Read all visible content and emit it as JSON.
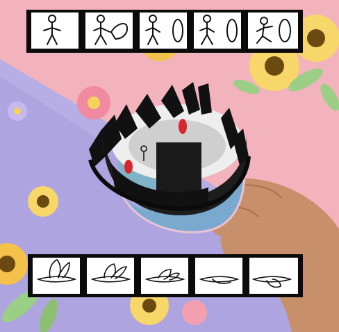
{
  "image": {
    "description_colors": {
      "pink_bg": "#f2b3bd",
      "purple_bg": "#b7aee6",
      "film_black": "#0b0b0b",
      "zoetrope_black": "#141414",
      "flower_yellow": "#f7d66a",
      "flower_center": "#6b4a12",
      "leaf_green": "#9ccf86"
    },
    "top_strip": {
      "frames": [
        {
          "label": "",
          "icon": "stick-figure-icon"
        },
        {
          "label": "",
          "icon": "stick-figure-throw-icon"
        },
        {
          "label": "",
          "icon": "stick-figure-ring-icon"
        },
        {
          "label": "",
          "icon": "stick-figure-ring-icon"
        },
        {
          "label": "",
          "icon": "stick-figure-jump-icon"
        }
      ]
    },
    "bottom_strip": {
      "frames": [
        {
          "label": "",
          "icon": "bird-wings-up-icon"
        },
        {
          "label": "",
          "icon": "bird-wings-mid-icon"
        },
        {
          "label": "",
          "icon": "bird-wings-mid-icon"
        },
        {
          "label": "",
          "icon": "bird-wings-down-icon"
        },
        {
          "label": "",
          "icon": "bird-wings-down-icon"
        }
      ]
    }
  }
}
